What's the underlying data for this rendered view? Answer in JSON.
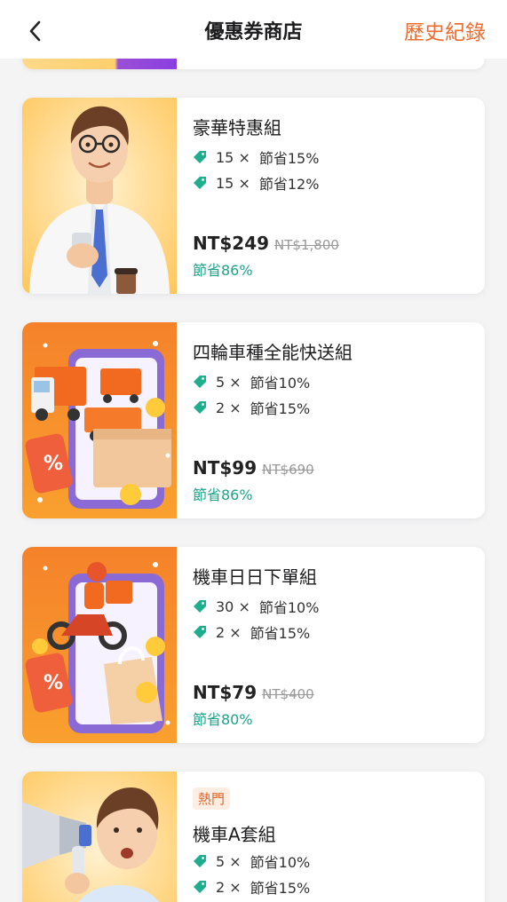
{
  "header": {
    "title": "優惠券商店",
    "history_label": "歷史紀錄"
  },
  "colors": {
    "accent": "#ef6c2f",
    "save_green": "#1aa58a",
    "tag_green": "#1fae8d"
  },
  "packages": [
    {
      "title": "豪華特惠組",
      "image_icon": "businessman-illustration",
      "coupons": [
        {
          "qty": "15 ×",
          "desc": "節省15%"
        },
        {
          "qty": "15 ×",
          "desc": "節省12%"
        }
      ],
      "price": "NT$249",
      "original_price": "NT$1,800",
      "savings": "節省86%"
    },
    {
      "title": "四輪車種全能快送組",
      "image_icon": "delivery-trucks-illustration",
      "coupons": [
        {
          "qty": "5 ×",
          "desc": "節省10%"
        },
        {
          "qty": "2 ×",
          "desc": "節省15%"
        }
      ],
      "price": "NT$99",
      "original_price": "NT$690",
      "savings": "節省86%"
    },
    {
      "title": "機車日日下單組",
      "image_icon": "motorcycle-courier-illustration",
      "coupons": [
        {
          "qty": "30 ×",
          "desc": "節省10%"
        },
        {
          "qty": "2 ×",
          "desc": "節省15%"
        }
      ],
      "price": "NT$79",
      "original_price": "NT$400",
      "savings": "節省80%"
    },
    {
      "badge": "熱門",
      "title": "機車A套組",
      "image_icon": "megaphone-man-illustration",
      "coupons": [
        {
          "qty": "5 ×",
          "desc": "節省10%"
        },
        {
          "qty": "2 ×",
          "desc": "節省15%"
        }
      ]
    }
  ]
}
